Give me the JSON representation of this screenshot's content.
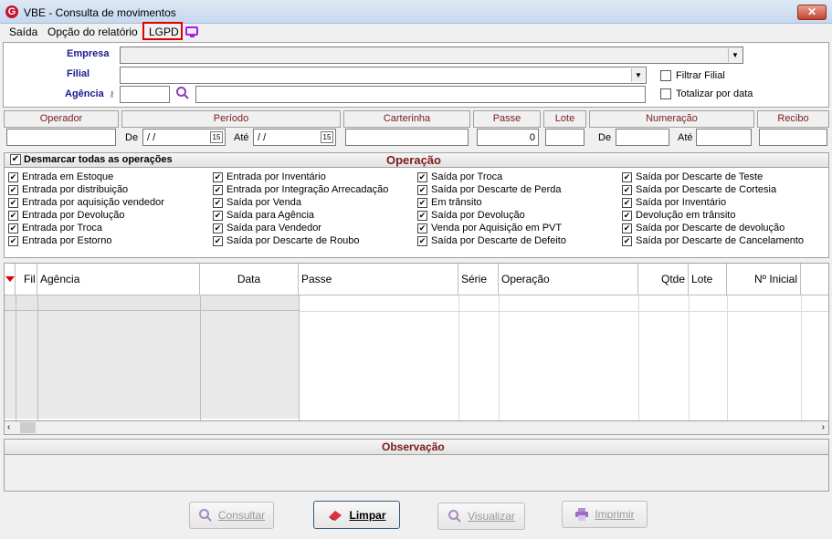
{
  "window": {
    "title": "VBE - Consulta de movimentos",
    "logo": "G",
    "close": "✕"
  },
  "menu": {
    "items": [
      "Saída",
      "Opção do relatório",
      "LGPD"
    ]
  },
  "form": {
    "empresa_label": "Empresa",
    "filial_label": "Filial",
    "agencia_label": "Agência",
    "filtrar_filial": "Filtrar Filial",
    "totalizar_por_data": "Totalizar por data"
  },
  "filters": {
    "headers": [
      "Operador",
      "Período",
      "Carterinha",
      "Passe",
      "Lote",
      "Numeração",
      "Recibo"
    ],
    "de": "De",
    "ate": "Até",
    "date_de": " / /",
    "date_ate": " / /",
    "cal": "15",
    "passe_value": "0"
  },
  "operacao": {
    "toggle_label": "Desmarcar todas as operações",
    "title": "Operação",
    "items": [
      [
        "Entrada em Estoque",
        "Entrada por distribuição",
        "Entrada por aquisição vendedor",
        "Entrada por Devolução",
        "Entrada por Troca",
        "Entrada por Estorno"
      ],
      [
        "Entrada por Inventário",
        "Entrada por Integração Arrecadação",
        "Saída por Venda",
        "Saída para Agência",
        "Saída para Vendedor",
        "Saída por Descarte de Roubo"
      ],
      [
        "Saída por Troca",
        "Saída por Descarte de Perda",
        "Em trânsito",
        "Saída por Devolução",
        "Venda por Aquisição em PVT",
        "Saída por Descarte de Defeito"
      ],
      [
        "Saída por Descarte de Teste",
        "Saída por Descarte de Cortesia",
        "Saída por Inventário",
        "Devolução em trânsito",
        "Saída por Descarte de devolução",
        "Saída por Descarte de Cancelamento"
      ]
    ]
  },
  "grid": {
    "columns": [
      "Fil",
      "Agência",
      "Data",
      "Passe",
      "Série",
      "Operação",
      "Qtde",
      "Lote",
      "Nº Inicial"
    ]
  },
  "observacao": {
    "title": "Observação"
  },
  "buttons": {
    "consultar": "Consultar",
    "limpar": "Limpar",
    "visualizar": "Visualizar",
    "imprimir": "Imprimir"
  },
  "colors": {
    "accent_red": "#7a1c1c",
    "label_blue": "#1a1a8c",
    "highlight": "#e00000"
  }
}
